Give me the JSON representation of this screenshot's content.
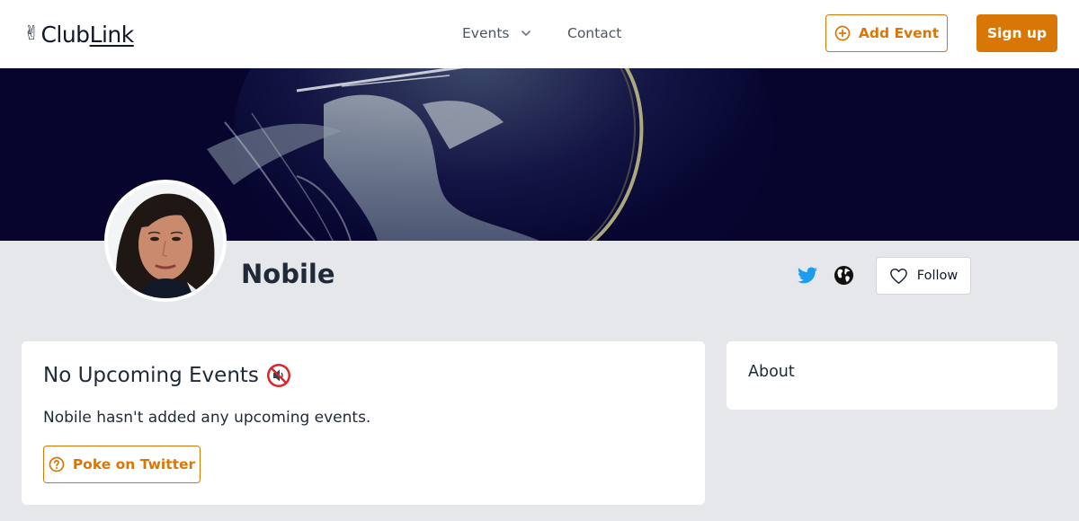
{
  "header": {
    "logo_emoji": "✌",
    "logo_part1": "Club",
    "logo_part2": "Link",
    "nav": {
      "events_label": "Events",
      "contact_label": "Contact"
    },
    "add_event_label": "Add Event",
    "signup_label": "Sign up"
  },
  "profile": {
    "name": "Nobile",
    "follow_label": "Follow"
  },
  "events_card": {
    "title": "No Upcoming Events",
    "message": "Nobile hasn't added any upcoming events.",
    "poke_label": "Poke on Twitter"
  },
  "about_card": {
    "title": "About"
  },
  "colors": {
    "accent": "#d97706",
    "background": "#e5e7eb",
    "banner": "#0a0833",
    "twitter": "#1d9bf0"
  },
  "icons": {
    "events_chevron": "chevron-down-icon",
    "add_event": "plus-circle-icon",
    "twitter": "twitter-icon",
    "website": "globe-icon",
    "follow": "heart-icon",
    "no_events": "muted-speaker-icon",
    "poke": "question-circle-icon"
  }
}
